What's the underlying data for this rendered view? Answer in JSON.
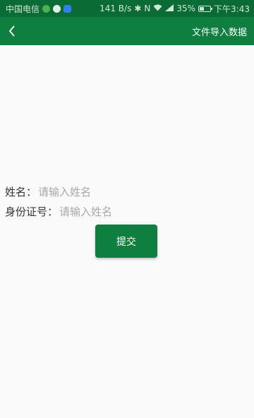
{
  "status_bar": {
    "carrier": "中国电信",
    "net_speed": "141 B/s",
    "battery": "35%",
    "time": "下午3:43"
  },
  "app_bar": {
    "title": "文件导入数据"
  },
  "form": {
    "name_label": "姓名：",
    "name_placeholder": "请输入姓名",
    "id_label": "身份证号：",
    "id_placeholder": "请输入姓名",
    "submit_label": "提交"
  },
  "colors": {
    "primary": "#0e7f3e",
    "status_bar": "#0b6b34",
    "background": "#fafafa"
  }
}
